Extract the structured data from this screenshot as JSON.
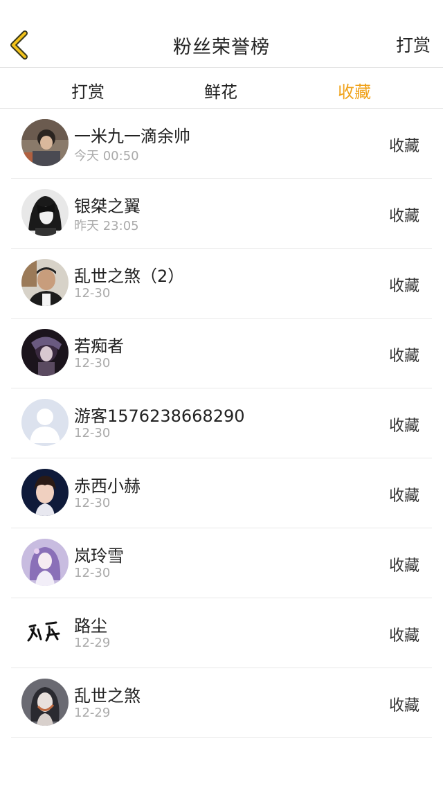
{
  "header": {
    "title": "粉丝荣誉榜",
    "right_label": "打赏",
    "back_icon": "chevron-left-icon",
    "accent": "#f0a21a"
  },
  "tabs": [
    {
      "label": "打赏",
      "active": false
    },
    {
      "label": "鲜花",
      "active": false
    },
    {
      "label": "收藏",
      "active": true
    }
  ],
  "fans": [
    {
      "name": "一米九一滴余帅",
      "time": "今天 00:50",
      "action": "收藏"
    },
    {
      "name": "银桀之翼",
      "time": "昨天 23:05",
      "action": "收藏"
    },
    {
      "name": "乱世之煞（2）",
      "time": "12-30",
      "action": "收藏"
    },
    {
      "name": "若痴者",
      "time": "12-30",
      "action": "收藏"
    },
    {
      "name": "游客1576238668290",
      "time": "12-30",
      "action": "收藏"
    },
    {
      "name": "赤西小赫",
      "time": "12-30",
      "action": "收藏"
    },
    {
      "name": "岚玲雪",
      "time": "12-30",
      "action": "收藏"
    },
    {
      "name": "路尘",
      "time": "12-29",
      "action": "收藏"
    },
    {
      "name": "乱世之煞",
      "time": "12-29",
      "action": "收藏"
    }
  ]
}
